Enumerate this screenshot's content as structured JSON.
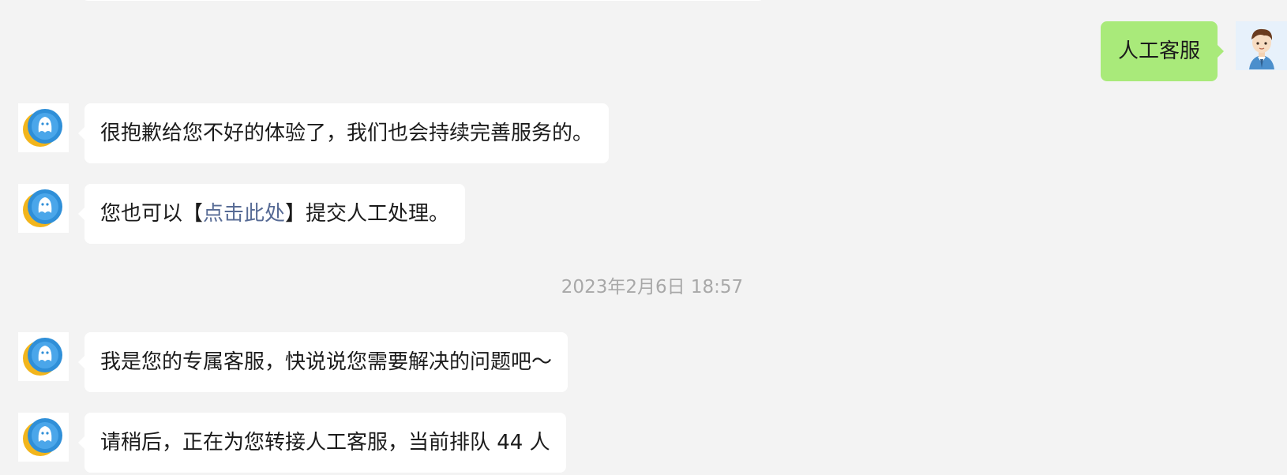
{
  "messages": {
    "user1": {
      "text": "人工客服"
    },
    "bot1": {
      "text": "很抱歉给您不好的体验了，我们也会持续完善服务的。"
    },
    "bot2": {
      "prefix": "您也可以【",
      "link": "点击此处",
      "suffix": "】提交人工处理。"
    },
    "timestamp": "2023年2月6日 18:57",
    "bot3": {
      "text": "我是您的专属客服，快说说您需要解决的问题吧～"
    },
    "bot4": {
      "text": "请稍后，正在为您转接人工客服，当前排队 44 人"
    }
  },
  "colors": {
    "background": "#f3f3f3",
    "user_bubble": "#a9ea7a",
    "bot_bubble": "#ffffff",
    "link": "#576b95",
    "timestamp": "#a8a8a8"
  },
  "icons": {
    "bot_avatar": "service-bot-avatar-icon",
    "user_avatar": "user-cartoon-avatar-icon"
  }
}
